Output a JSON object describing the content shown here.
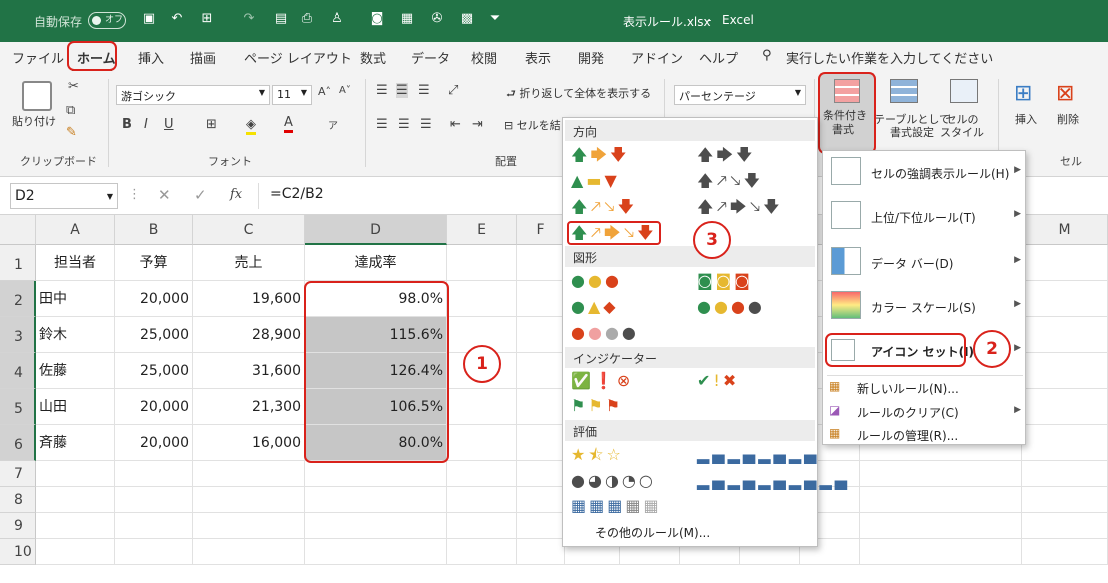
{
  "title": {
    "autosave": "自動保存",
    "autosave_state": "オフ",
    "filename": "表示ルール.xlsx",
    "sep": "-",
    "app": "Excel"
  },
  "tabs": [
    "ファイル",
    "ホーム",
    "挿入",
    "描画",
    "ページ レイアウト",
    "数式",
    "データ",
    "校閲",
    "表示",
    "開発",
    "アドイン",
    "ヘルプ"
  ],
  "tell_me": "実行したい作業を入力してください",
  "ribbon": {
    "clipboard": {
      "paste": "貼り付け",
      "group": "クリップボード"
    },
    "font": {
      "name": "游ゴシック",
      "size": "11",
      "group": "フォント",
      "bold": "B",
      "italic": "I",
      "underline": "U"
    },
    "align": {
      "wrap": "折り返して全体を表示する",
      "merge": "セルを結",
      "group": "配置"
    },
    "number": {
      "format": "パーセンテージ"
    },
    "styles": {
      "cond": "条件付き\n書式",
      "cond1": "条件付き",
      "cond2": "書式",
      "table1": "テーブルとして",
      "table2": "書式設定",
      "cell1": "セルの",
      "cell2": "スタイル"
    },
    "cells": {
      "insert": "挿入",
      "delete": "削除",
      "group": "セル"
    }
  },
  "formula": {
    "name_box": "D2",
    "fx": "fx",
    "value": "=C2/B2"
  },
  "sheet": {
    "columns": [
      "A",
      "B",
      "C",
      "D",
      "E",
      "F",
      "",
      "",
      "",
      "",
      "",
      "",
      "M"
    ],
    "rows": [
      "1",
      "2",
      "3",
      "4",
      "5",
      "6",
      "7",
      "8",
      "9",
      "10"
    ],
    "header": [
      "担当者",
      "予算",
      "売上",
      "達成率"
    ],
    "data": [
      [
        "田中",
        "20,000",
        "19,600",
        "98.0%"
      ],
      [
        "鈴木",
        "25,000",
        "28,900",
        "115.6%"
      ],
      [
        "佐藤",
        "25,000",
        "31,600",
        "126.4%"
      ],
      [
        "山田",
        "20,000",
        "21,300",
        "106.5%"
      ],
      [
        "斉藤",
        "20,000",
        "16,000",
        "80.0%"
      ]
    ]
  },
  "iconset_menu": {
    "sections": [
      "方向",
      "図形",
      "インジケーター",
      "評価"
    ],
    "more": "その他のルール(M)..."
  },
  "cf_menu": {
    "items": [
      "セルの強調表示ルール(H)",
      "上位/下位ルール(T)",
      "データ バー(D)",
      "カラー スケール(S)",
      "アイコン セット(I)"
    ],
    "small": [
      "新しいルール(N)...",
      "ルールのクリア(C)",
      "ルールの管理(R)..."
    ]
  },
  "callouts": [
    "1",
    "2",
    "3"
  ],
  "colors": {
    "excel_green": "#217346",
    "highlight_red": "#d9221b",
    "selection": "#c6c6c6"
  }
}
